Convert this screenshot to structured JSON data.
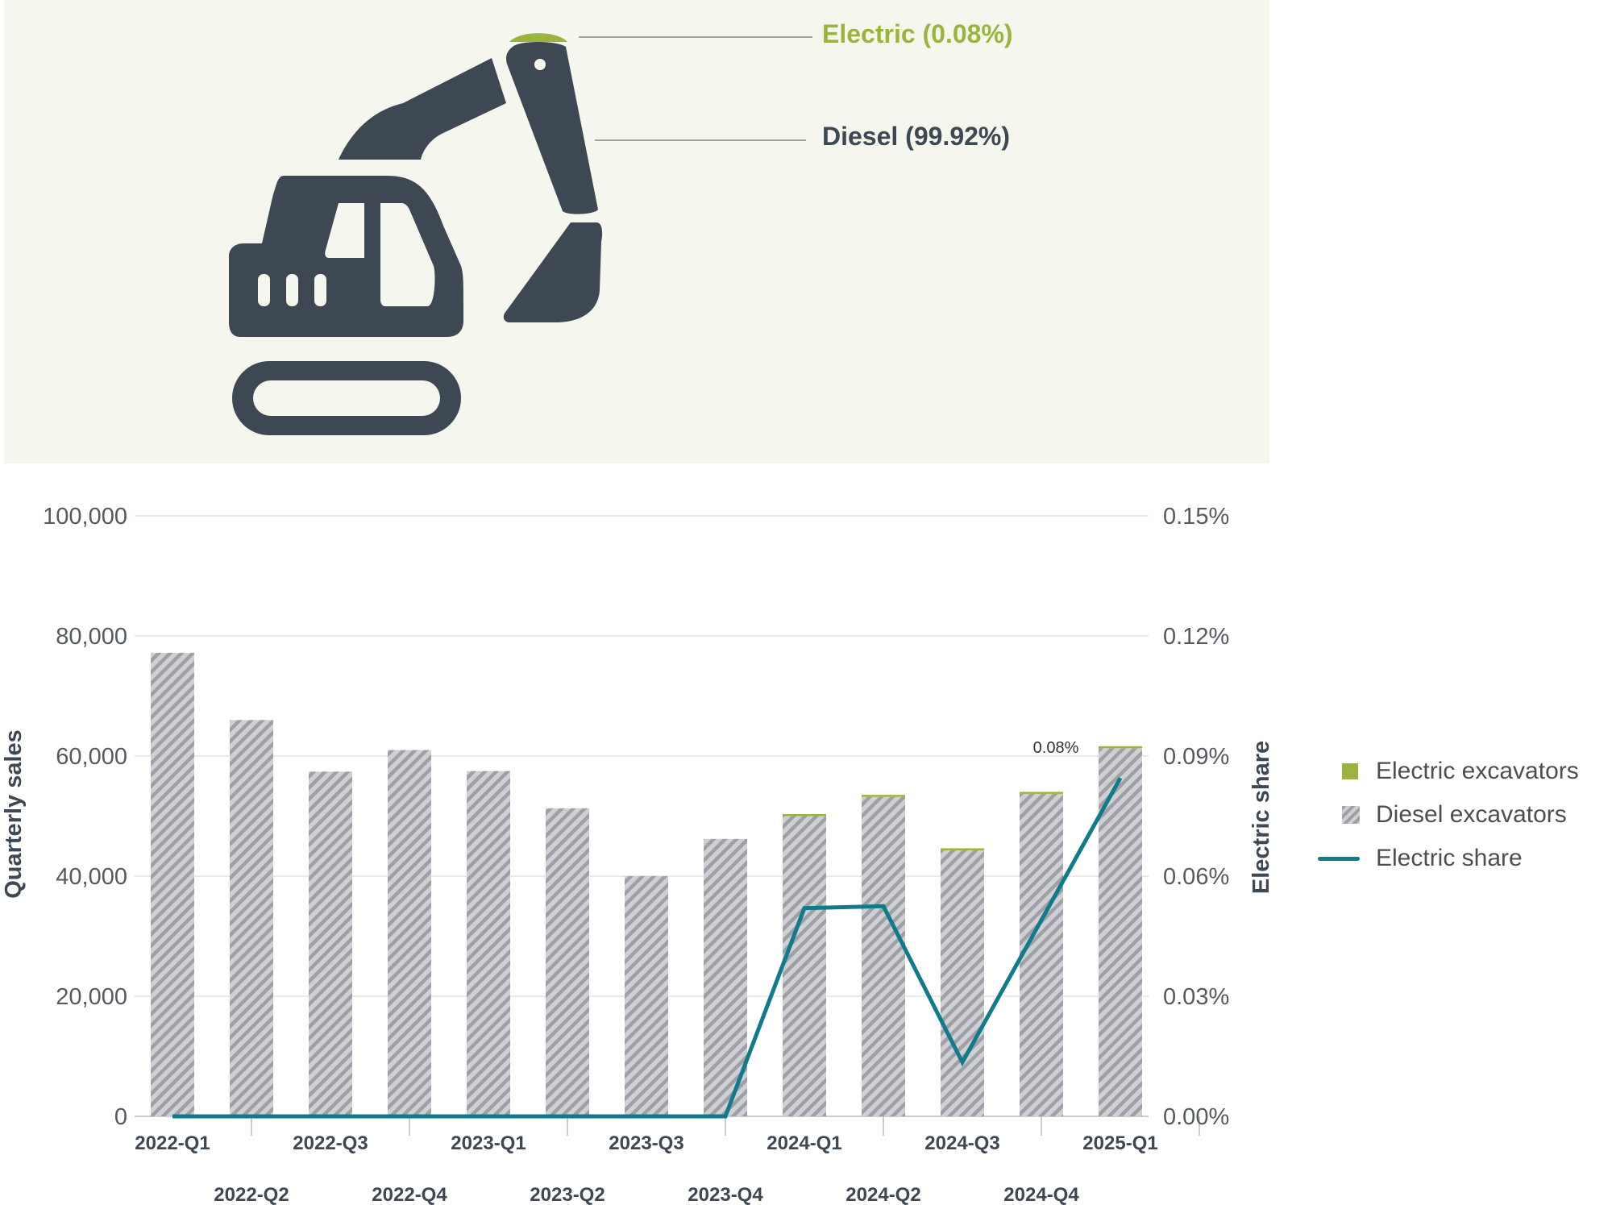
{
  "callouts": {
    "electric": "Electric (0.08%)",
    "diesel": "Diesel (99.92%)"
  },
  "colors": {
    "electric": "#9bb53c",
    "diesel": "#3d4852",
    "share_line": "#117a8b",
    "hero_bg": "#f5f6ee"
  },
  "icons": [
    "excavator-icon"
  ],
  "legend": {
    "electric": "Electric excavators",
    "diesel": "Diesel excavators",
    "share": "Electric share"
  },
  "chart_data": {
    "type": "bar",
    "stacked": true,
    "categories": [
      "2022-Q1",
      "2022-Q2",
      "2022-Q3",
      "2022-Q4",
      "2023-Q1",
      "2023-Q2",
      "2023-Q3",
      "2023-Q4",
      "2024-Q1",
      "2024-Q2",
      "2024-Q3",
      "2024-Q4",
      "2025-Q1"
    ],
    "series": [
      {
        "name": "Electric excavators",
        "type": "bar",
        "values": [
          0,
          0,
          0,
          0,
          0,
          0,
          0,
          0,
          26,
          28,
          6,
          27,
          50
        ]
      },
      {
        "name": "Diesel excavators",
        "type": "bar",
        "pattern": "hatched",
        "values": [
          77200,
          66000,
          57400,
          61000,
          57500,
          51300,
          40000,
          46200,
          50000,
          53200,
          44300,
          53700,
          61300
        ]
      },
      {
        "name": "Electric share",
        "type": "line",
        "axis": "right",
        "values": [
          0,
          0,
          0,
          0,
          0,
          0,
          0,
          0,
          0.052,
          0.0525,
          0.0135,
          0.049,
          0.0845
        ]
      }
    ],
    "ylabel": "Quarterly sales",
    "y2label": "Electric share",
    "ylim": [
      0,
      100000
    ],
    "y2lim": [
      0,
      0.15
    ],
    "yticks": [
      "0",
      "20,000",
      "40,000",
      "60,000",
      "80,000",
      "100,000"
    ],
    "y2ticks": [
      "0.00%",
      "0.03%",
      "0.06%",
      "0.09%",
      "0.12%",
      "0.15%"
    ],
    "annotation": {
      "category": "2025-Q1",
      "text": "0.08%"
    },
    "grid": true,
    "legend_position": "right"
  }
}
